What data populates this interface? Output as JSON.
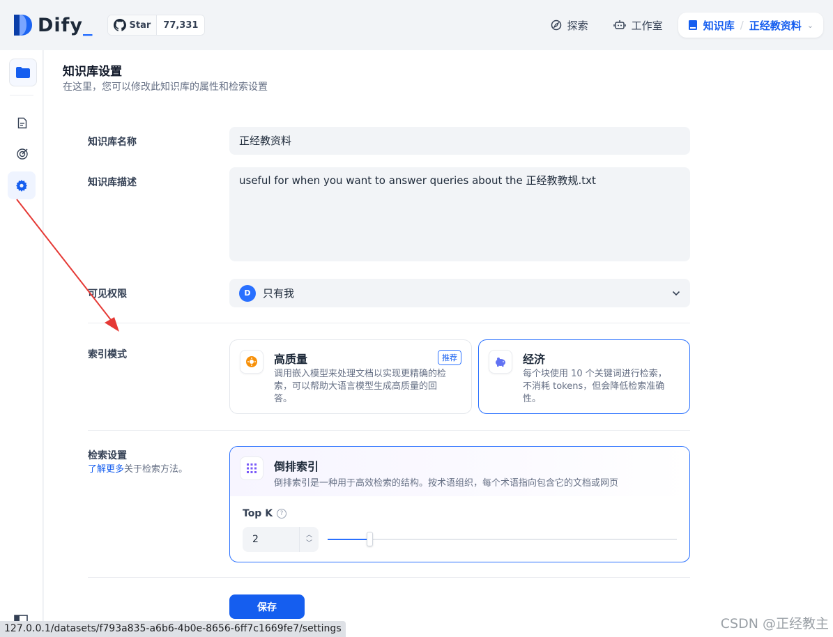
{
  "header": {
    "logo_text": "Dify",
    "github": {
      "star_label": "Star",
      "count": "77,331"
    },
    "nav": {
      "explore": "探索",
      "studio": "工作室"
    },
    "breadcrumb": {
      "root": "知识库",
      "separator": "/",
      "current": "正经教资料"
    }
  },
  "page": {
    "title": "知识库设置",
    "subtitle": "在这里，您可以修改此知识库的属性和检索设置"
  },
  "form": {
    "name": {
      "label": "知识库名称",
      "value": "正经教资料"
    },
    "description": {
      "label": "知识库描述",
      "value": "useful for when you want to answer queries about the 正经教教规.txt"
    },
    "permission": {
      "label": "可见权限",
      "avatar_initial": "D",
      "value": "只有我"
    },
    "index_mode": {
      "label": "索引模式",
      "options": [
        {
          "title": "高质量",
          "badge": "推荐",
          "desc_lines": [
            "调用嵌入模型来处理文档以实现更精确的检",
            "索，可以帮助大语言模型生成高质量的回",
            "答。"
          ],
          "selected": false
        },
        {
          "title": "经济",
          "desc_lines": [
            "每个块使用 10 个关键词进行检索，",
            "不消耗 tokens，但会降低检索准确",
            "性。"
          ],
          "selected": true
        }
      ]
    },
    "retrieval": {
      "label": "检索设置",
      "learn_more": "了解更多",
      "learn_more_suffix": "关于检索方法。",
      "method_title": "倒排索引",
      "method_desc": "倒排索引是一种用于高效检索的结构。按术语组织，每个术语指向包含它的文档或网页",
      "top_k_label": "Top K",
      "top_k_value": "2",
      "top_k_fraction": 0.12
    },
    "save_label": "保存"
  },
  "browser": {
    "status_url": "127.0.0.1/datasets/f793a835-a6b6-4b0e-8656-6ff7c1669fe7/settings",
    "watermark": "CSDN @正经教主"
  },
  "colors": {
    "accent": "#155eef",
    "annotation_arrow": "#e53935"
  }
}
